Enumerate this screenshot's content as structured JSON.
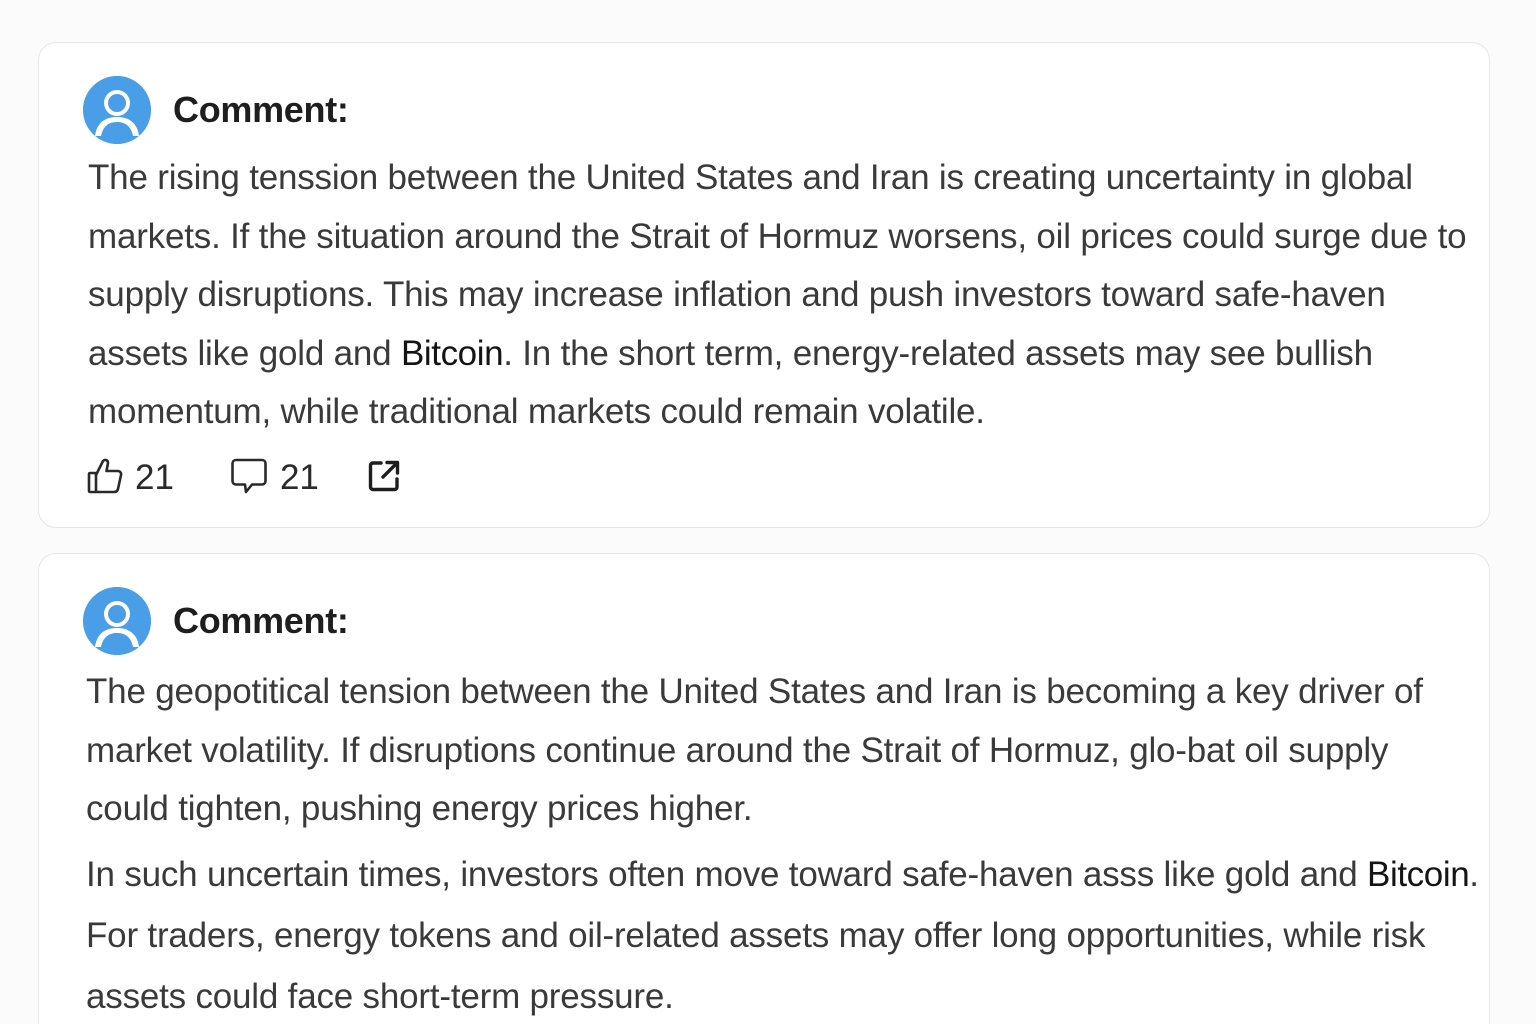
{
  "comments": [
    {
      "label": "Comment:",
      "avatar": "user-avatar-icon",
      "paragraphs": [
        {
          "before": "The rising tenssion between the United States and Iran is creating uncertainty in global markets. If the situation around the Strait of Hormuz worsens, oil prices could surge due to supply disruptions. This may increase inflation and push investors toward safe-haven assets like gold and ",
          "term": "Bitcoin",
          "after": ". In the short term, energy-related assets may see bullish momentum, while traditional markets could remain volatile."
        }
      ],
      "actions": {
        "like_count": "21",
        "reply_count": "21",
        "like_icon": "thumbs-up-icon",
        "reply_icon": "speech-bubble-icon",
        "share_icon": "share-icon"
      }
    },
    {
      "label": "Comment:",
      "avatar": "user-avatar-icon",
      "paragraphs": [
        {
          "before": "The geopotitical tension between the United States and Iran is becoming a key driver of market volatility. If disruptions continue around the Strait of Hormuz, glo-bat oil supply could tighten, pushing energy prices higher.",
          "term": "",
          "after": ""
        },
        {
          "before": "In such uncertain times, investors often move toward safe-haven asss like gold and ",
          "term": "Bitcoin",
          "after": ". For traders, energy tokens and oil-related assets may offer long opportunities, while risk assets could face short-term pressure."
        }
      ]
    }
  ],
  "colors": {
    "avatar_bg": "#4a9ee8",
    "text": "#3a3a3a",
    "heading": "#1e1e1e",
    "card_border": "#e6e6e6"
  }
}
